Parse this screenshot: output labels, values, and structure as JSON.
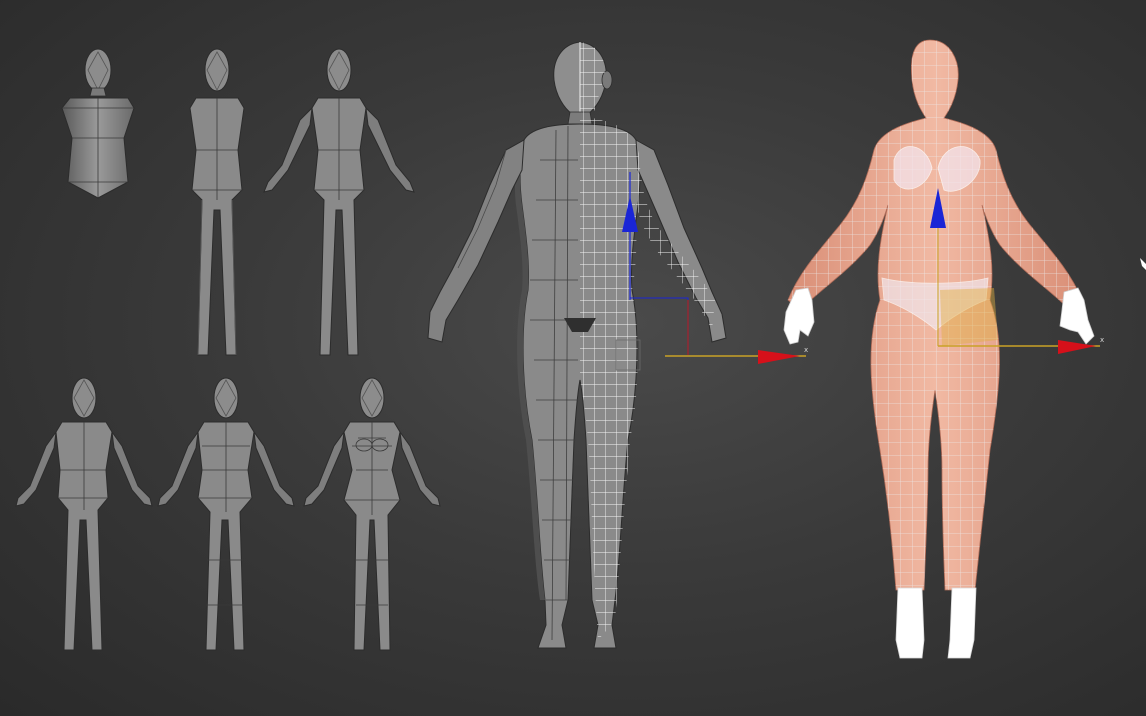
{
  "viewport": {
    "background": "#3a3a3a",
    "background_edge": "#2a2a2a"
  },
  "colors": {
    "mesh_fill": "#8a8a8a",
    "mesh_shadow": "#4e4e4e",
    "mesh_light": "#a3a3a3",
    "mesh_edge": "#2c2c2c",
    "wire_white": "#f2f2f2",
    "skin": "#e8a38a",
    "skin_light": "#f3c0ad",
    "glove": "#ffffff",
    "gizmo_x": "#d6101a",
    "gizmo_y": "#1a25d6",
    "gizmo_line": "#c9a226",
    "gizmo_box": "#b8182a"
  },
  "icons": {
    "gizmo": "move-gizmo-icon",
    "cursor": "mouse-cursor-icon"
  },
  "gizmo_mid": {
    "axis_label": "x"
  },
  "gizmo_right": {
    "axis_label": "x"
  }
}
